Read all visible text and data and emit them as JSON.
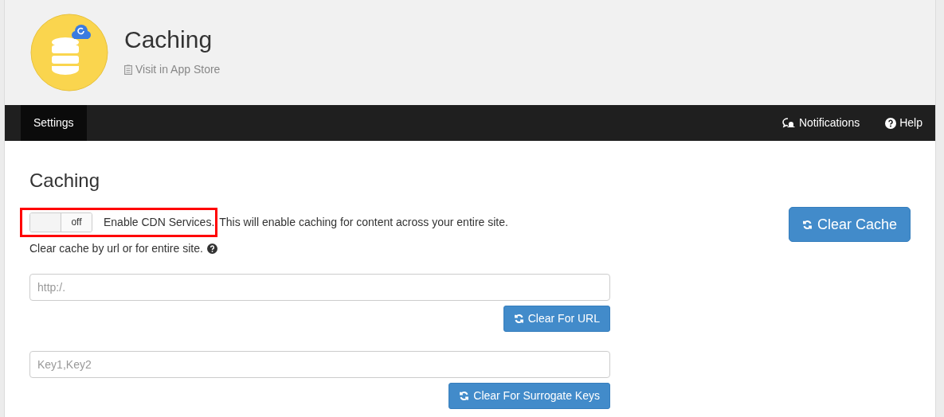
{
  "app": {
    "title": "Caching",
    "store_link": "Visit in App Store"
  },
  "nav": {
    "tabs": [
      {
        "label": "Settings",
        "selected": true
      }
    ],
    "right": [
      {
        "kind": "notifications",
        "label": "Notifications"
      },
      {
        "kind": "help",
        "label": "Help"
      }
    ]
  },
  "section": {
    "title": "Caching",
    "clear_cache_button": "Clear Cache",
    "cdn_toggle": {
      "on": false,
      "label_off": "off",
      "highlighted": true,
      "label": "Enable CDN Services.",
      "description": "This will enable caching for content across your entire site."
    },
    "hint": "Clear cache by url or for entire site.",
    "forms": [
      {
        "placeholder": "http:/.",
        "button": "Clear For URL"
      },
      {
        "placeholder": "Key1,Key2",
        "button": "Clear For Surrogate Keys"
      }
    ]
  }
}
